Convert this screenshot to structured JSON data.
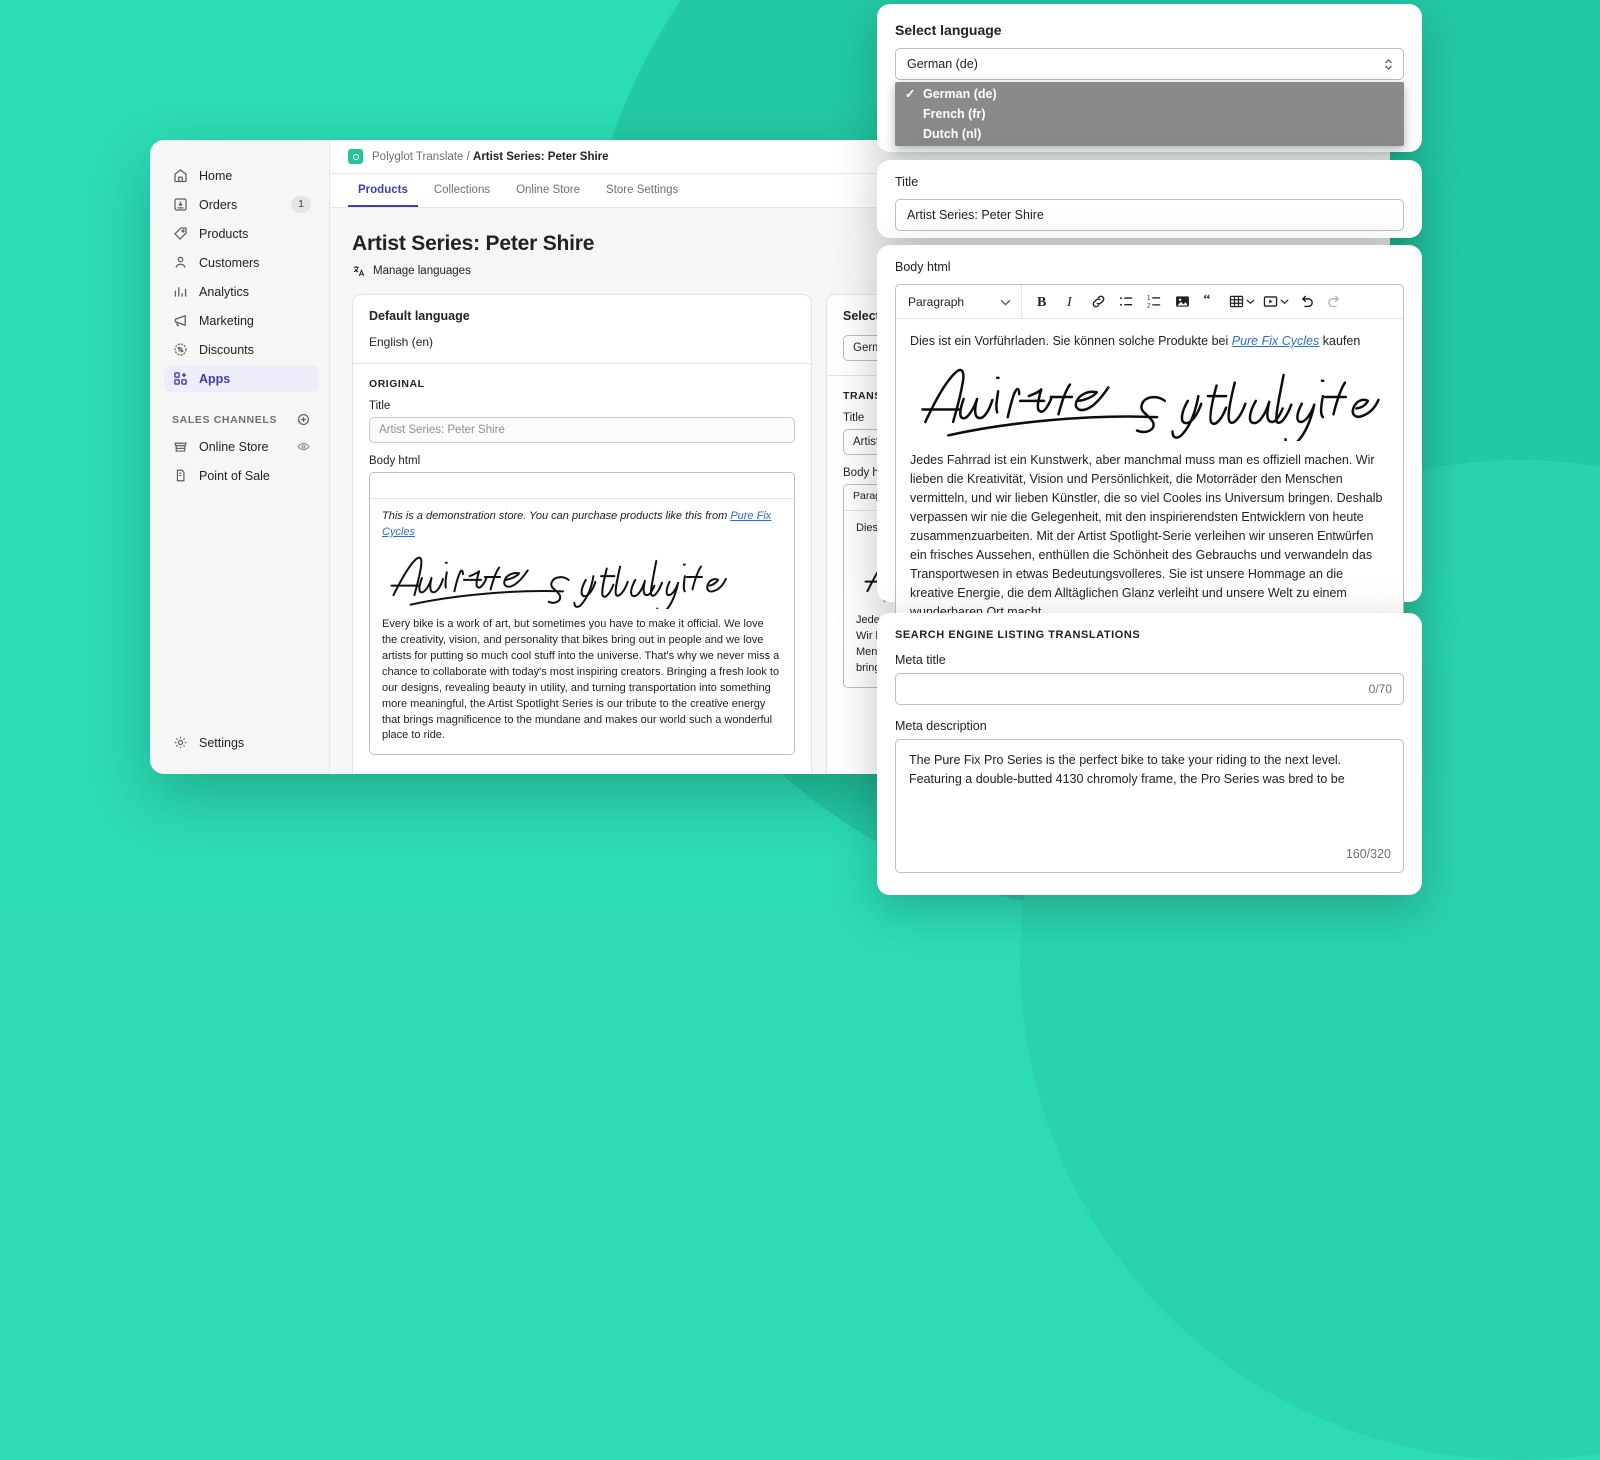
{
  "theme": {
    "background": "#2cdcb4",
    "accent": "#3b3fb6",
    "brand_green": "#25c49a"
  },
  "sidebar": {
    "items": [
      {
        "label": "Home",
        "icon": "home-icon",
        "badge": ""
      },
      {
        "label": "Orders",
        "icon": "orders-icon",
        "badge": "1"
      },
      {
        "label": "Products",
        "icon": "tag-icon",
        "badge": ""
      },
      {
        "label": "Customers",
        "icon": "person-icon",
        "badge": ""
      },
      {
        "label": "Analytics",
        "icon": "bar-chart-icon",
        "badge": ""
      },
      {
        "label": "Marketing",
        "icon": "megaphone-icon",
        "badge": ""
      },
      {
        "label": "Discounts",
        "icon": "discount-icon",
        "badge": ""
      },
      {
        "label": "Apps",
        "icon": "apps-icon",
        "badge": ""
      }
    ],
    "section_title": "SALES CHANNELS",
    "channels": [
      {
        "label": "Online Store",
        "icon": "store-icon",
        "trailing_icon": "eye-icon"
      },
      {
        "label": "Point of Sale",
        "icon": "pos-icon",
        "trailing_icon": ""
      }
    ],
    "settings_label": "Settings",
    "settings_icon": "gear-icon",
    "add_channel_icon": "plus-circle-icon"
  },
  "header": {
    "app_name": "Polyglot Translate",
    "separator": "/",
    "page": "Artist Series: Peter Shire",
    "app_icon": "app-logo-icon"
  },
  "tabs": [
    {
      "label": "Products",
      "active": true
    },
    {
      "label": "Collections",
      "active": false
    },
    {
      "label": "Online Store",
      "active": false
    },
    {
      "label": "Store Settings",
      "active": false
    }
  ],
  "page": {
    "title": "Artist Series: Peter Shire",
    "manage_languages": "Manage languages",
    "manage_languages_icon": "translate-icon"
  },
  "default_card": {
    "heading": "Default language",
    "language": "English (en)",
    "eyebrow": "ORIGINAL",
    "title_label": "Title",
    "title_value": "Artist Series: Peter Shire",
    "body_label": "Body html",
    "intro_pre": "This is a demonstration store. You can purchase products like this from ",
    "intro_link": "Pure Fix Cycles",
    "signature_text": "Artist Spotlight",
    "paragraph": "Every bike is a work of art, but sometimes you have to make it official. We love the creativity, vision, and personality that bikes bring out in people and we love artists for putting so much cool stuff into the universe. That's why we never miss a chance to collaborate with today's most inspiring creators. Bringing a fresh look to our designs, revealing beauty in utility, and turning transportation into something more meaningful, the Artist Spotlight Series is our tribute to the creative energy that brings magnificence to the mundane and makes our world such a wonderful place to ride."
  },
  "translation_card": {
    "heading": "Select language",
    "language": "German (de)",
    "eyebrow": "TRANSLATION",
    "title_label": "Title",
    "title_value": "Artist Series: Peter Shire",
    "body_label": "Body html",
    "toolbar_block": "Paragraph",
    "intro": "Dies ist ein Vorführladen. Sie können solche Produkte bei Pure Fix Cycles kaufen",
    "paragraph": "Jedes Fahrrad ist ein Kunstwerk, aber manchmal muss man es offiziell machen. Wir lieben die Kreativität, Vision und Persönlichkeit, die Motorräder den Menschen vermitteln, und wir lieben Künstler, die so viel Cooles ins Universum bringen."
  },
  "lang_panel": {
    "heading": "Select language",
    "selected": "German (de)",
    "select_icon": "updown-caret-icon",
    "options": [
      {
        "label": "German (de)",
        "checked": true
      },
      {
        "label": "French (fr)",
        "checked": false
      },
      {
        "label": "Dutch (nl)",
        "checked": false
      }
    ],
    "check_glyph": "✓"
  },
  "title_panel": {
    "label": "Title",
    "value": "Artist Series: Peter Shire"
  },
  "body_panel": {
    "label": "Body html",
    "block_format": "Paragraph",
    "toolbar": [
      {
        "name": "bold-icon",
        "label": "B"
      },
      {
        "name": "italic-icon",
        "label": "I"
      },
      {
        "name": "link-icon",
        "label": "link"
      },
      {
        "name": "bulleted-list-icon",
        "label": "bulleted list"
      },
      {
        "name": "numbered-list-icon",
        "label": "numbered list"
      },
      {
        "name": "image-icon",
        "label": "image"
      },
      {
        "name": "blockquote-icon",
        "label": "quote"
      },
      {
        "name": "table-icon",
        "label": "table"
      },
      {
        "name": "video-icon",
        "label": "video"
      },
      {
        "name": "undo-icon",
        "label": "undo"
      },
      {
        "name": "redo-icon",
        "label": "redo"
      }
    ],
    "intro_pre": "Dies ist ein Vorführladen. Sie können solche Produkte bei ",
    "intro_link": "Pure Fix Cycles",
    "intro_post": " kaufen",
    "signature_text": "Artist Spotlight",
    "paragraph": "Jedes Fahrrad ist ein Kunstwerk, aber manchmal muss man es offiziell machen. Wir lieben die Kreativität, Vision und Persönlichkeit, die Motorräder den Menschen vermitteln, und wir lieben Künstler, die so viel Cooles ins Universum bringen. Deshalb verpassen wir nie die Gelegenheit, mit den inspirierendsten Entwicklern von heute zusammenzuarbeiten. Mit der Artist Spotlight-Serie verleihen wir unseren Entwürfen ein frisches Aussehen, enthüllen die Schönheit des Gebrauchs und verwandeln das Transportwesen in etwas Bedeutungsvolleres. Sie ist unsere Hommage an die kreative Energie, die dem Alltäglichen Glanz verleiht und unsere Welt zu einem wunderbaren Ort macht."
  },
  "seo_panel": {
    "eyebrow": "SEARCH ENGINE LISTING TRANSLATIONS",
    "meta_title_label": "Meta title",
    "meta_title_value": "",
    "meta_title_counter": "0/70",
    "meta_description_label": "Meta description",
    "meta_description_value": "The Pure Fix Pro Series is the perfect bike to take your riding to the next level.  Featuring a double-butted 4130 chromoly frame, the Pro Series was bred to be",
    "meta_description_counter": "160/320"
  }
}
